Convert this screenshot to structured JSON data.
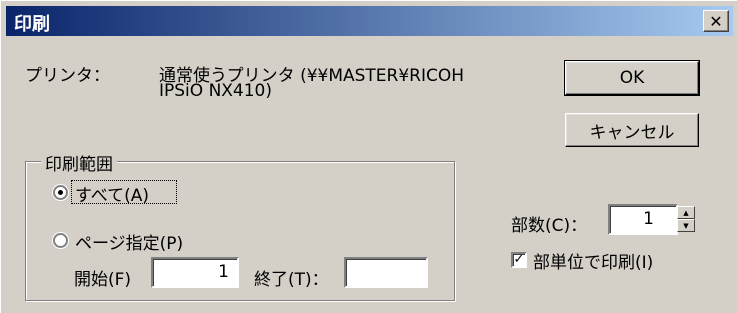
{
  "window": {
    "title": "印刷",
    "close_label": "✕"
  },
  "printer": {
    "label": "プリンタ：",
    "value_line1": "通常使うプリンタ (¥¥MASTER¥RICOH",
    "value_line2": "IPSiO NX410)"
  },
  "buttons": {
    "ok": "OK",
    "cancel": "キャンセル"
  },
  "print_range": {
    "group_label": "印刷範囲",
    "options": [
      {
        "label": "すべて(A)",
        "selected": true
      },
      {
        "label": "ページ指定(P)",
        "selected": false
      }
    ],
    "start_label": "開始(F)",
    "start_value": "1",
    "end_label": "終了(T)：",
    "end_value": ""
  },
  "copies": {
    "label": "部数(C)：",
    "value": "1",
    "collate_label": "部単位で印刷(I)",
    "collate_checked": true
  }
}
